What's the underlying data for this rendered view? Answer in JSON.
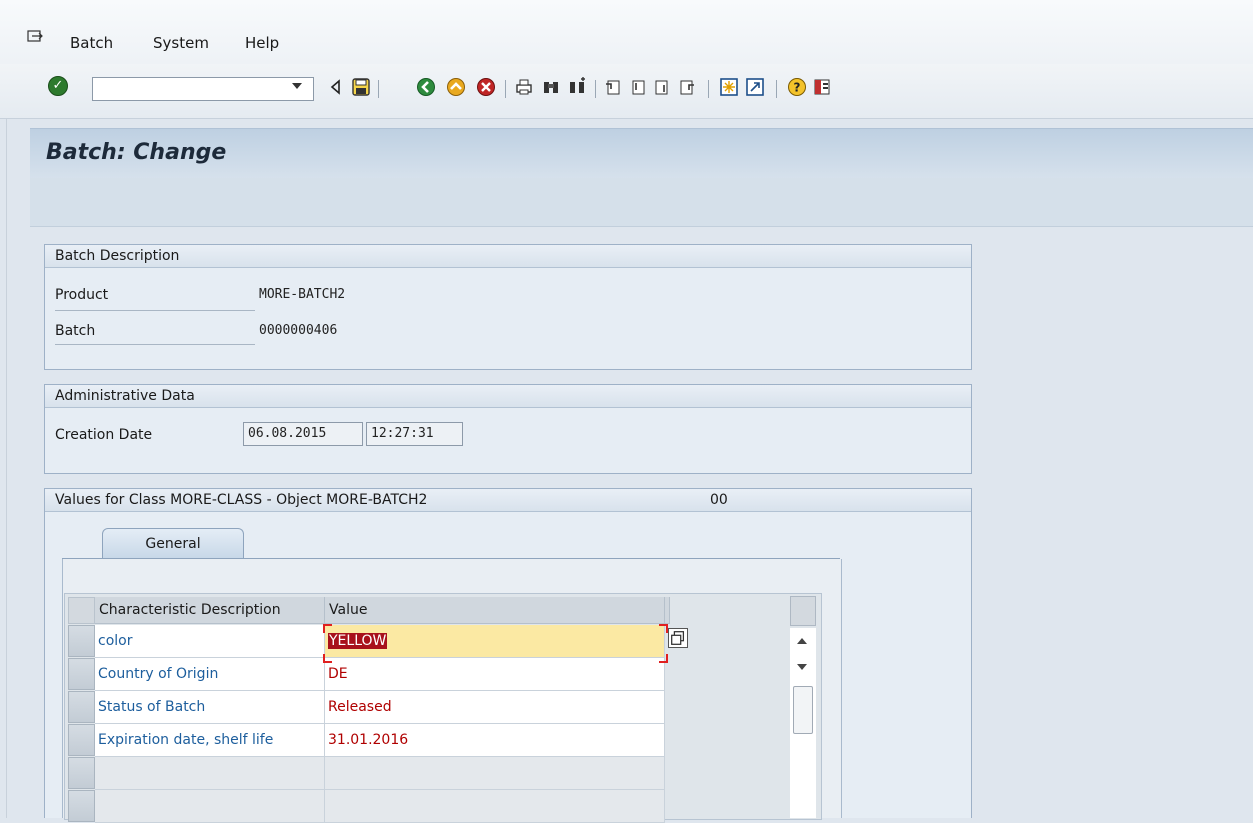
{
  "menu": {
    "items": [
      {
        "label": "Batch"
      },
      {
        "label": "System"
      },
      {
        "label": "Help"
      }
    ]
  },
  "toolbar": {
    "command_field_value": "",
    "icons": [
      "enter-check-icon",
      "back-arrow-icon",
      "save-icon",
      "back-icon",
      "exit-icon",
      "cancel-icon",
      "print-icon",
      "find-icon",
      "find-next-icon",
      "first-page-icon",
      "previous-page-icon",
      "next-page-icon",
      "last-page-icon",
      "create-session-icon",
      "shortcut-icon",
      "help-icon",
      "customize-layout-icon"
    ]
  },
  "title": "Batch: Change",
  "batch_description": {
    "header": "Batch Description",
    "product_label": "Product",
    "product_value": "MORE-BATCH2",
    "batch_label": "Batch",
    "batch_value": "0000000406"
  },
  "admin_data": {
    "header": "Administrative Data",
    "creation_label": "Creation Date",
    "creation_date": "06.08.2015",
    "creation_time": "12:27:31"
  },
  "class_values": {
    "header": "Values for Class MORE-CLASS - Object MORE-BATCH2",
    "header_code": "00",
    "tab_label": "General",
    "columns": [
      "Characteristic Description",
      "Value"
    ],
    "rows": [
      {
        "desc": "color",
        "value": "YELLOW"
      },
      {
        "desc": "Country of Origin",
        "value": "DE"
      },
      {
        "desc": "Status of Batch",
        "value": "Released"
      },
      {
        "desc": "Expiration date, shelf life",
        "value": "31.01.2016"
      },
      {
        "desc": "",
        "value": ""
      },
      {
        "desc": "",
        "value": ""
      }
    ]
  }
}
